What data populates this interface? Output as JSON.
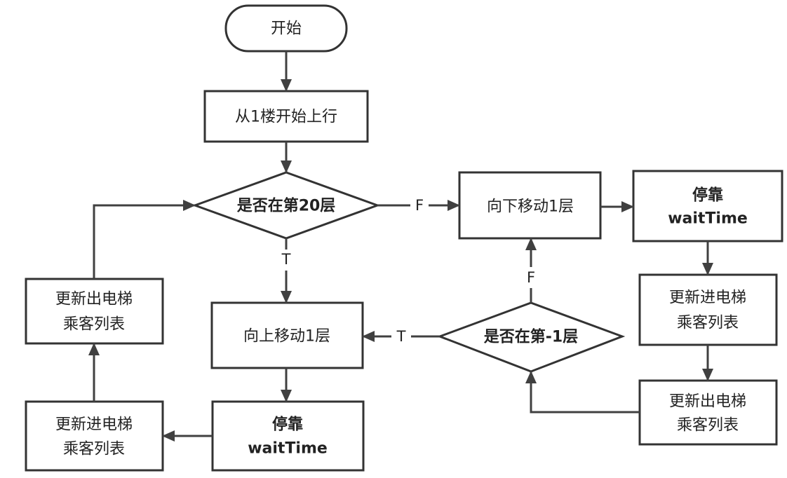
{
  "colors": {
    "stroke": "#333333",
    "arrow": "#404040",
    "text": "#222222",
    "background": "#ffffff"
  },
  "nodes": {
    "start": {
      "label": "开始"
    },
    "init": {
      "label": "从1楼开始上行"
    },
    "check_top_floor": {
      "label": "是否在第20层"
    },
    "move_down": {
      "label": "向下移动1层"
    },
    "stop_right": {
      "line1": "停靠",
      "line2": "waitTime"
    },
    "update_in_right": {
      "line1": "更新进电梯",
      "line2": "乘客列表"
    },
    "update_out_right": {
      "line1": "更新出电梯",
      "line2": "乘客列表"
    },
    "check_bottom_floor": {
      "label": "是否在第-1层"
    },
    "move_up": {
      "label": "向上移动1层"
    },
    "stop_left": {
      "line1": "停靠",
      "line2": "waitTime"
    },
    "update_in_left": {
      "line1": "更新进电梯",
      "line2": "乘客列表"
    },
    "update_out_left": {
      "line1": "更新出电梯",
      "line2": "乘客列表"
    }
  },
  "edges": {
    "top_false_label": "F",
    "top_true_label": "T",
    "bottom_false_label": "F",
    "bottom_true_label": "T"
  }
}
